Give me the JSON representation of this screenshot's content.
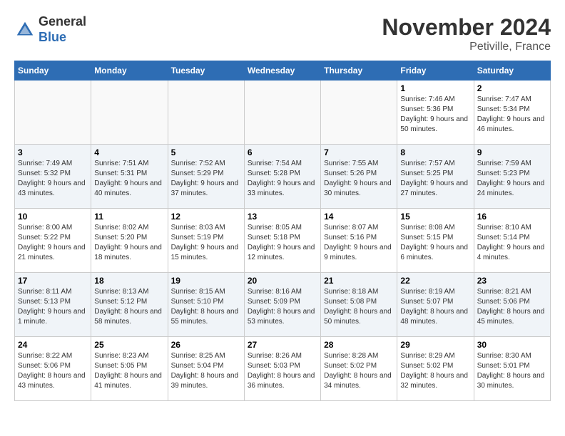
{
  "logo": {
    "line1": "General",
    "line2": "Blue"
  },
  "title": "November 2024",
  "location": "Petiville, France",
  "days_of_week": [
    "Sunday",
    "Monday",
    "Tuesday",
    "Wednesday",
    "Thursday",
    "Friday",
    "Saturday"
  ],
  "weeks": [
    [
      {
        "day": "",
        "info": ""
      },
      {
        "day": "",
        "info": ""
      },
      {
        "day": "",
        "info": ""
      },
      {
        "day": "",
        "info": ""
      },
      {
        "day": "",
        "info": ""
      },
      {
        "day": "1",
        "info": "Sunrise: 7:46 AM\nSunset: 5:36 PM\nDaylight: 9 hours and 50 minutes."
      },
      {
        "day": "2",
        "info": "Sunrise: 7:47 AM\nSunset: 5:34 PM\nDaylight: 9 hours and 46 minutes."
      }
    ],
    [
      {
        "day": "3",
        "info": "Sunrise: 7:49 AM\nSunset: 5:32 PM\nDaylight: 9 hours and 43 minutes."
      },
      {
        "day": "4",
        "info": "Sunrise: 7:51 AM\nSunset: 5:31 PM\nDaylight: 9 hours and 40 minutes."
      },
      {
        "day": "5",
        "info": "Sunrise: 7:52 AM\nSunset: 5:29 PM\nDaylight: 9 hours and 37 minutes."
      },
      {
        "day": "6",
        "info": "Sunrise: 7:54 AM\nSunset: 5:28 PM\nDaylight: 9 hours and 33 minutes."
      },
      {
        "day": "7",
        "info": "Sunrise: 7:55 AM\nSunset: 5:26 PM\nDaylight: 9 hours and 30 minutes."
      },
      {
        "day": "8",
        "info": "Sunrise: 7:57 AM\nSunset: 5:25 PM\nDaylight: 9 hours and 27 minutes."
      },
      {
        "day": "9",
        "info": "Sunrise: 7:59 AM\nSunset: 5:23 PM\nDaylight: 9 hours and 24 minutes."
      }
    ],
    [
      {
        "day": "10",
        "info": "Sunrise: 8:00 AM\nSunset: 5:22 PM\nDaylight: 9 hours and 21 minutes."
      },
      {
        "day": "11",
        "info": "Sunrise: 8:02 AM\nSunset: 5:20 PM\nDaylight: 9 hours and 18 minutes."
      },
      {
        "day": "12",
        "info": "Sunrise: 8:03 AM\nSunset: 5:19 PM\nDaylight: 9 hours and 15 minutes."
      },
      {
        "day": "13",
        "info": "Sunrise: 8:05 AM\nSunset: 5:18 PM\nDaylight: 9 hours and 12 minutes."
      },
      {
        "day": "14",
        "info": "Sunrise: 8:07 AM\nSunset: 5:16 PM\nDaylight: 9 hours and 9 minutes."
      },
      {
        "day": "15",
        "info": "Sunrise: 8:08 AM\nSunset: 5:15 PM\nDaylight: 9 hours and 6 minutes."
      },
      {
        "day": "16",
        "info": "Sunrise: 8:10 AM\nSunset: 5:14 PM\nDaylight: 9 hours and 4 minutes."
      }
    ],
    [
      {
        "day": "17",
        "info": "Sunrise: 8:11 AM\nSunset: 5:13 PM\nDaylight: 9 hours and 1 minute."
      },
      {
        "day": "18",
        "info": "Sunrise: 8:13 AM\nSunset: 5:12 PM\nDaylight: 8 hours and 58 minutes."
      },
      {
        "day": "19",
        "info": "Sunrise: 8:15 AM\nSunset: 5:10 PM\nDaylight: 8 hours and 55 minutes."
      },
      {
        "day": "20",
        "info": "Sunrise: 8:16 AM\nSunset: 5:09 PM\nDaylight: 8 hours and 53 minutes."
      },
      {
        "day": "21",
        "info": "Sunrise: 8:18 AM\nSunset: 5:08 PM\nDaylight: 8 hours and 50 minutes."
      },
      {
        "day": "22",
        "info": "Sunrise: 8:19 AM\nSunset: 5:07 PM\nDaylight: 8 hours and 48 minutes."
      },
      {
        "day": "23",
        "info": "Sunrise: 8:21 AM\nSunset: 5:06 PM\nDaylight: 8 hours and 45 minutes."
      }
    ],
    [
      {
        "day": "24",
        "info": "Sunrise: 8:22 AM\nSunset: 5:06 PM\nDaylight: 8 hours and 43 minutes."
      },
      {
        "day": "25",
        "info": "Sunrise: 8:23 AM\nSunset: 5:05 PM\nDaylight: 8 hours and 41 minutes."
      },
      {
        "day": "26",
        "info": "Sunrise: 8:25 AM\nSunset: 5:04 PM\nDaylight: 8 hours and 39 minutes."
      },
      {
        "day": "27",
        "info": "Sunrise: 8:26 AM\nSunset: 5:03 PM\nDaylight: 8 hours and 36 minutes."
      },
      {
        "day": "28",
        "info": "Sunrise: 8:28 AM\nSunset: 5:02 PM\nDaylight: 8 hours and 34 minutes."
      },
      {
        "day": "29",
        "info": "Sunrise: 8:29 AM\nSunset: 5:02 PM\nDaylight: 8 hours and 32 minutes."
      },
      {
        "day": "30",
        "info": "Sunrise: 8:30 AM\nSunset: 5:01 PM\nDaylight: 8 hours and 30 minutes."
      }
    ]
  ]
}
